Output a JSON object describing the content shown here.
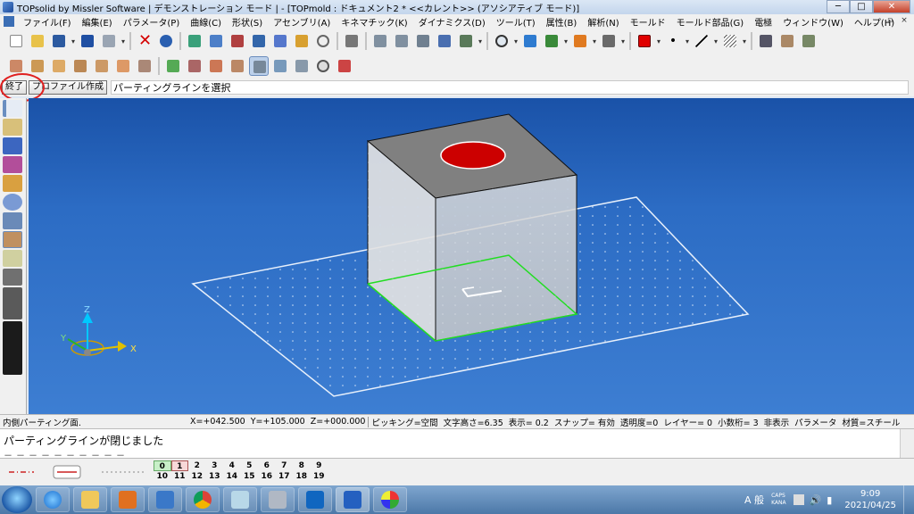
{
  "window": {
    "title": "TOPsolid by Missler Software | デモンストレーション モード | - [TOPmold : ドキュメント2 *  <<カレント>> (アソシアティブ モード)]",
    "min": "─",
    "max": "□",
    "close": "✕"
  },
  "menu": {
    "items": [
      "ファイル(F)",
      "編集(E)",
      "パラメータ(P)",
      "曲線(C)",
      "形状(S)",
      "アセンブリ(A)",
      "キネマチック(K)",
      "ダイナミクス(D)",
      "ツール(T)",
      "属性(B)",
      "解析(N)",
      "モールド",
      "モールド部品(G)",
      "電極",
      "ウィンドウ(W)",
      "ヘルプ(H)"
    ],
    "mdi": [
      "_",
      "▫",
      "×"
    ]
  },
  "command": {
    "end_button": "終了",
    "profile_button": "プロファイル作成",
    "prompt": "パーティングラインを選択"
  },
  "colors": {
    "current_color": "#e00000",
    "viewport_top": "#1a52a8",
    "viewport_bottom": "#3d7ed2",
    "edge_green": "#22dd22",
    "hole_red": "#cc0000"
  },
  "axes": {
    "z": "Z",
    "x": "X",
    "y": "Y"
  },
  "status": {
    "label": "内側パーティング面.",
    "x": "X=+042.500",
    "y": "Y=+105.000",
    "z": "Z=+000.000",
    "picking": "ピッキング=空間",
    "text_height": "文字高さ=6.35",
    "display": "表示=  0.2",
    "snap": "スナップ= 有効",
    "transparency": "透明度=0",
    "layer": "レイヤー= 0",
    "decimals": "小数桁= 3",
    "hidden": "非表示",
    "param": "パラメータ",
    "material": "材質=スチール"
  },
  "messages": {
    "line1": "パーティングラインが閉じました",
    "line2": "－－－－－－－－－－"
  },
  "layers": {
    "row1": [
      "0",
      "1",
      "2",
      "3",
      "4",
      "5",
      "6",
      "7",
      "8",
      "9"
    ],
    "row2": [
      "10",
      "11",
      "12",
      "13",
      "14",
      "15",
      "16",
      "17",
      "18",
      "19"
    ]
  },
  "taskbar": {
    "apps": [
      "windows-media-player",
      "internet-explorer",
      "file-explorer",
      "media-player",
      "edit-app",
      "chrome",
      "notepad",
      "calculator",
      "outlook",
      "topsolid",
      "paint"
    ],
    "ime": "A 般",
    "caps": "CAPS",
    "kana": "KANA",
    "time": "9:09",
    "date": "2021/04/25"
  }
}
